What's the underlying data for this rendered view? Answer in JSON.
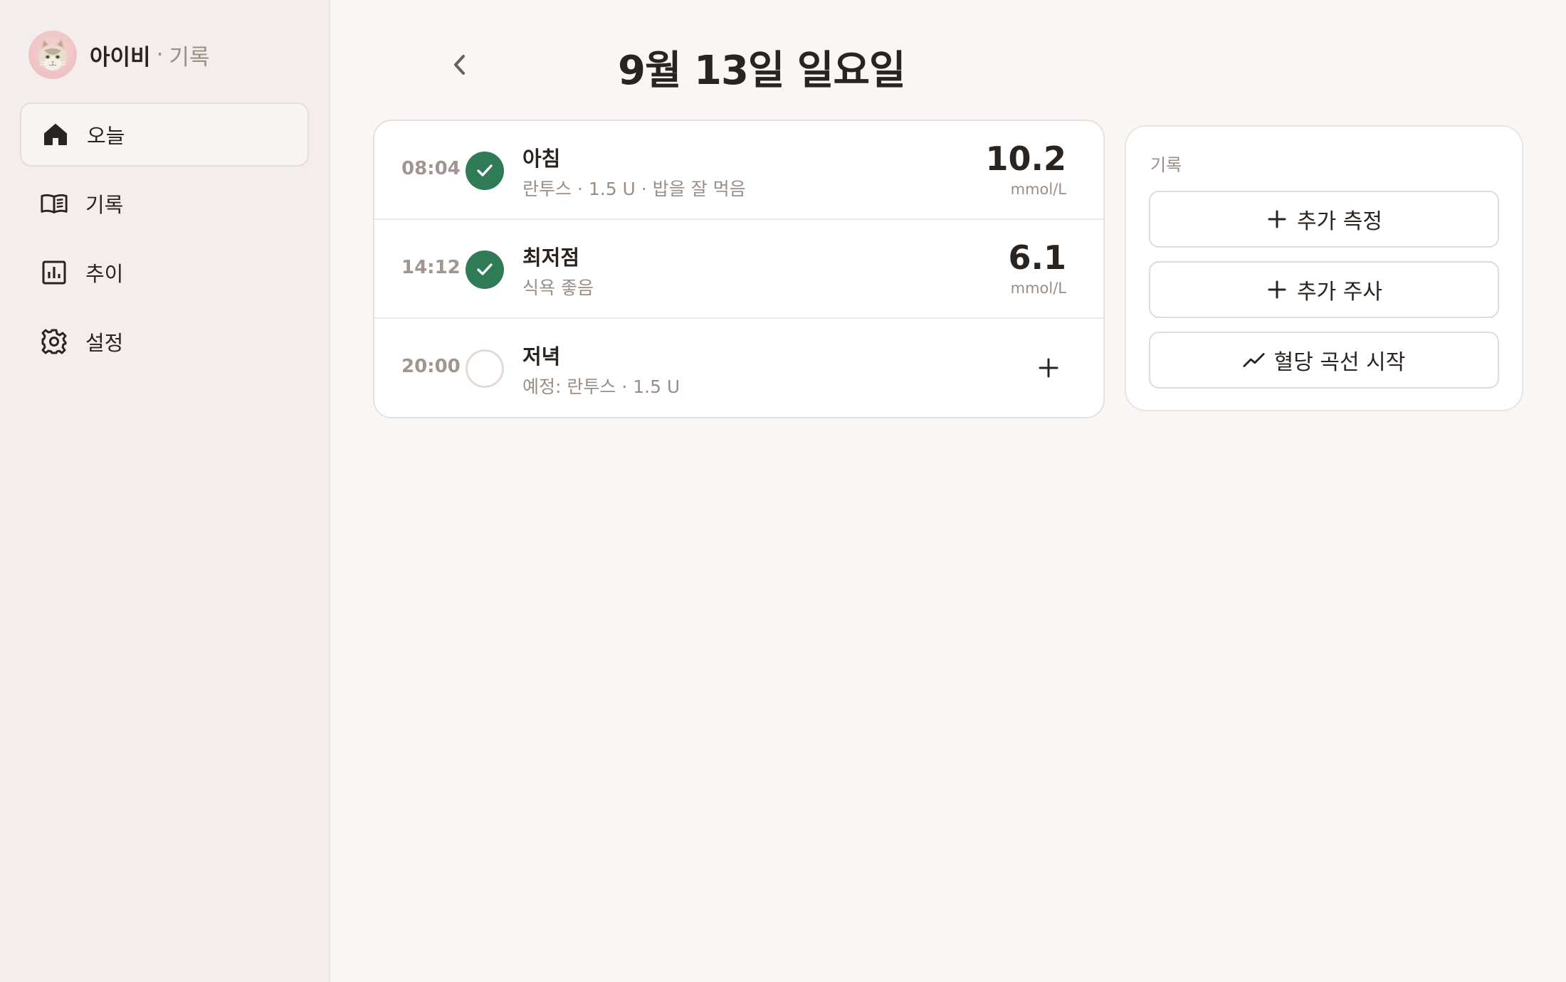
{
  "brand": {
    "name": "아이비",
    "separator": "·",
    "section": "기록"
  },
  "nav": [
    {
      "label": "오늘",
      "icon": "home-icon",
      "active": true
    },
    {
      "label": "기록",
      "icon": "book-icon",
      "active": false
    },
    {
      "label": "추이",
      "icon": "chart-icon",
      "active": false
    },
    {
      "label": "설정",
      "icon": "gear-icon",
      "active": false
    }
  ],
  "header": {
    "title": "9월 13일 일요일"
  },
  "entries": [
    {
      "time": "08:04",
      "status": "done",
      "title": "아침",
      "subtitle": "란투스 · 1.5 U · 밥을 잘 먹음",
      "value": "10.2",
      "unit": "mmol/L"
    },
    {
      "time": "14:12",
      "status": "done",
      "title": "최저점",
      "subtitle": "식욕 좋음",
      "value": "6.1",
      "unit": "mmol/L"
    },
    {
      "time": "20:00",
      "status": "pending",
      "title": "저녁",
      "subtitle": "예정: 란투스 · 1.5 U"
    }
  ],
  "panel": {
    "label": "기록",
    "buttons": [
      {
        "label": "추가 측정",
        "icon": "plus-icon"
      },
      {
        "label": "추가 주사",
        "icon": "plus-icon"
      },
      {
        "label": "혈당 곡선 시작",
        "icon": "trend-icon"
      }
    ]
  },
  "colors": {
    "accent_green": "#2f7a57",
    "sidebar_bg": "#f3eeeb",
    "muted_text": "#9a8d86"
  }
}
